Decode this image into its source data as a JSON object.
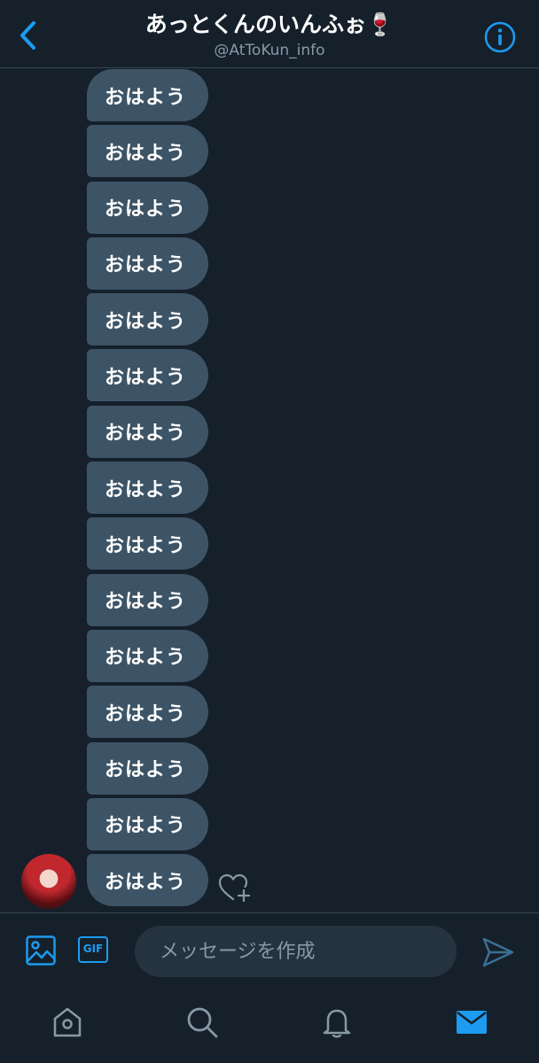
{
  "header": {
    "title": "あっとくんのいんふぉ🍷",
    "handle": "@AtToKun_info"
  },
  "messages": [
    {
      "text": "おはよう"
    },
    {
      "text": "おはよう"
    },
    {
      "text": "おはよう"
    },
    {
      "text": "おはよう"
    },
    {
      "text": "おはよう"
    },
    {
      "text": "おはよう"
    },
    {
      "text": "おはよう"
    },
    {
      "text": "おはよう"
    },
    {
      "text": "おはよう"
    },
    {
      "text": "おはよう"
    },
    {
      "text": "おはよう"
    },
    {
      "text": "おはよう"
    },
    {
      "text": "おはよう"
    },
    {
      "text": "おはよう"
    },
    {
      "text": "おはよう"
    }
  ],
  "composer": {
    "gif_label": "GIF",
    "placeholder": "メッセージを作成"
  },
  "icons": {
    "back": "chevron-left-icon",
    "info": "info-icon",
    "like": "heart-plus-icon",
    "media": "image-icon",
    "send": "send-icon",
    "tabs": [
      "home-icon",
      "search-icon",
      "bell-icon",
      "mail-icon"
    ]
  },
  "colors": {
    "background": "#15202b",
    "accent": "#1d9bf0",
    "bubble": "#3d5466",
    "muted": "#8899a6"
  }
}
